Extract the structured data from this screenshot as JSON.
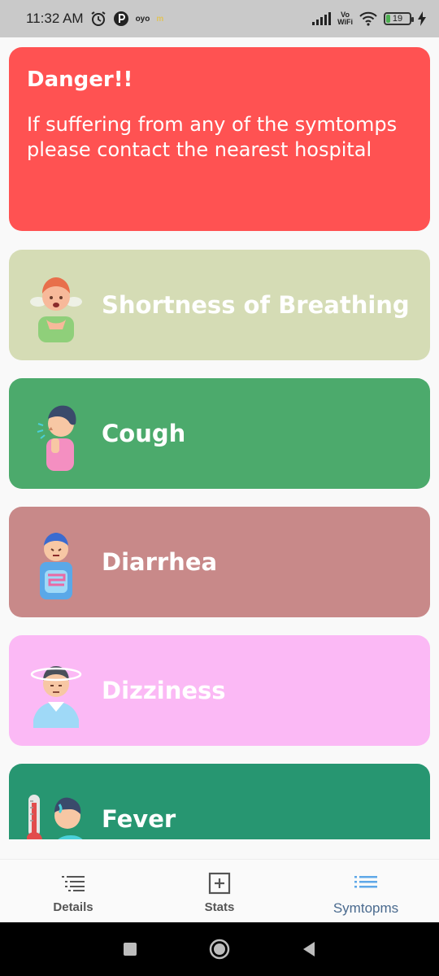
{
  "status_bar": {
    "time": "11:32 AM",
    "left_icons": [
      "alarm-icon",
      "app-p-icon",
      "oyo-icon",
      "m-icon"
    ],
    "oyo_label": "oyo",
    "m_label": "m",
    "vowifi_top": "Vo",
    "vowifi_bottom": "WiFi",
    "battery_level": "19"
  },
  "danger": {
    "title": "Danger!!",
    "message": "If suffering from any of the symtomps please contact the nearest hospital",
    "color": "#ff5252"
  },
  "symptoms": [
    {
      "label": "Shortness of Breathing",
      "color": "#d5dcb5",
      "icon": "breathless-person-icon"
    },
    {
      "label": "Cough",
      "color": "#4caa6c",
      "icon": "coughing-person-icon"
    },
    {
      "label": "Diarrhea",
      "color": "#c88989",
      "icon": "stomach-ache-person-icon"
    },
    {
      "label": "Dizziness",
      "color": "#fbb9f5",
      "icon": "dizzy-person-icon"
    },
    {
      "label": "Fever",
      "color": "#279671",
      "icon": "fever-person-icon"
    }
  ],
  "bottom_nav": {
    "items": [
      {
        "label": "Details",
        "icon": "list-icon",
        "active": false
      },
      {
        "label": "Stats",
        "icon": "plus-box-icon",
        "active": false
      },
      {
        "label": "Symtopms",
        "icon": "list-icon",
        "active": true
      }
    ]
  },
  "system_nav": [
    "recents-button",
    "home-button",
    "back-button"
  ]
}
